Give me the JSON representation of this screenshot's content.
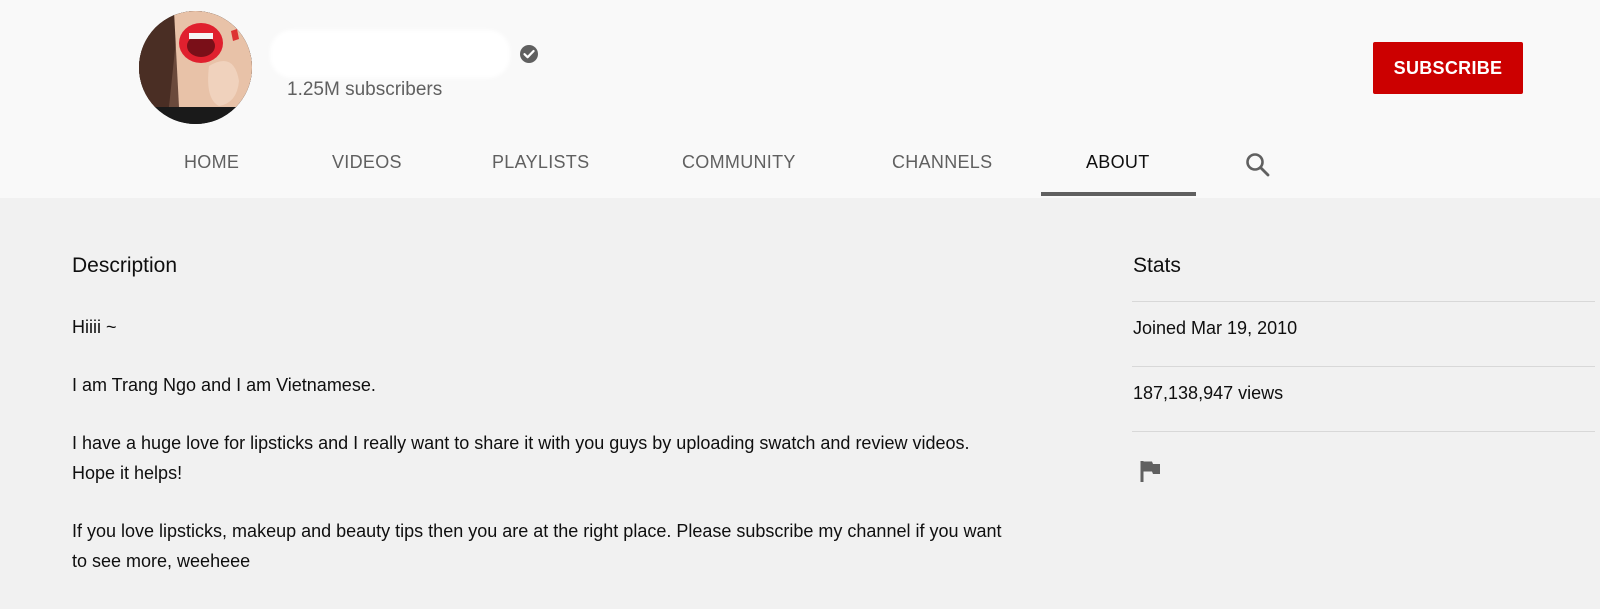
{
  "channel": {
    "subscribers": "1.25M subscribers",
    "verified_icon": "verified-check-icon",
    "subscribe_label": "SUBSCRIBE",
    "brand_color": "#cc0000"
  },
  "tabs": [
    {
      "label": "HOME"
    },
    {
      "label": "VIDEOS"
    },
    {
      "label": "PLAYLISTS"
    },
    {
      "label": "COMMUNITY"
    },
    {
      "label": "CHANNELS"
    },
    {
      "label": "ABOUT",
      "active": true
    }
  ],
  "tab_search_icon": "search-icon",
  "about": {
    "description_title": "Description",
    "description_lines": [
      "Hiiii ~",
      "I am Trang Ngo and I am Vietnamese.",
      "I have a huge love for lipsticks and I really want to share it with you guys by uploading swatch and review videos. Hope it helps!",
      "If you love lipsticks, makeup and beauty tips then you are at the right place. Please subscribe my channel if you want to see more, weeheee"
    ],
    "stats_title": "Stats",
    "joined": "Joined Mar 19, 2010",
    "views": "187,138,947 views",
    "report_icon": "flag-icon"
  }
}
